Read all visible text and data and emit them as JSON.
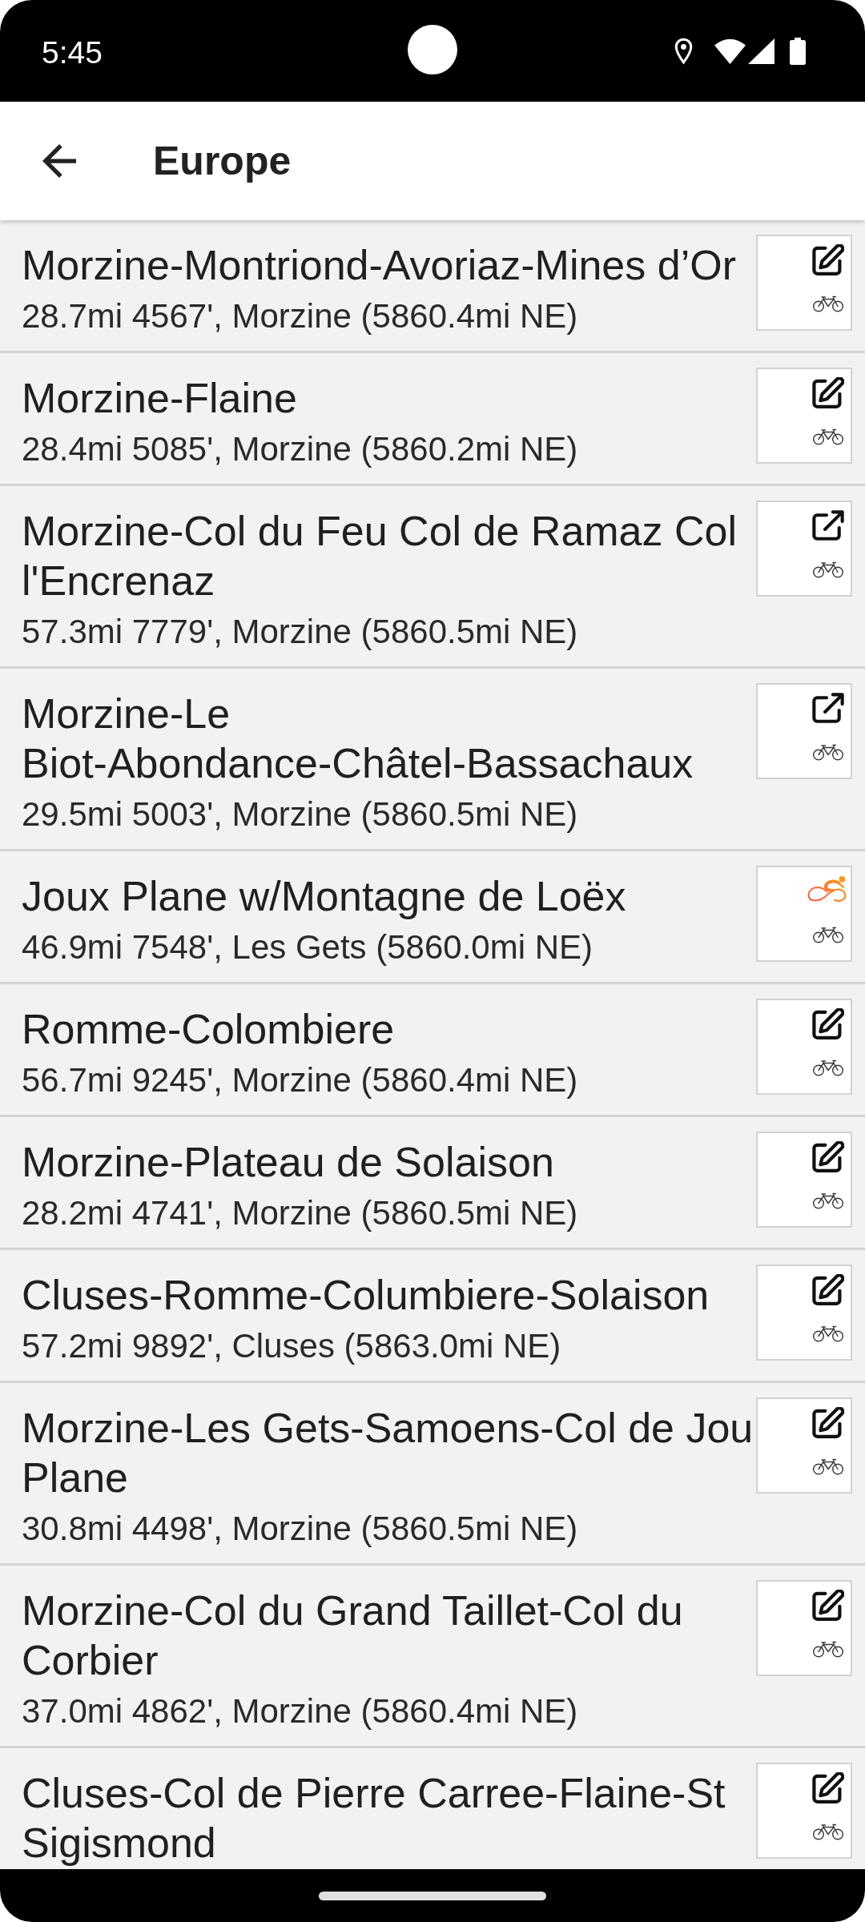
{
  "status_bar": {
    "time": "5:45"
  },
  "app_bar": {
    "title": "Europe"
  },
  "routes": [
    {
      "title": "Morzine-Montriond-Avoriaz-Mines d’Or",
      "details": "28.7mi 4567', Morzine (5860.4mi NE)",
      "kind": "edit"
    },
    {
      "title": "Morzine-Flaine",
      "details": "28.4mi 5085', Morzine (5860.2mi NE)",
      "kind": "edit"
    },
    {
      "title": "Morzine-Col du Feu Col de Ramaz Col\nl'Encrenaz",
      "details": "57.3mi 7779', Morzine (5860.5mi NE)",
      "kind": "external"
    },
    {
      "title": "Morzine-Le\nBiot-Abondance-Châtel-Bassachaux",
      "details": "29.5mi 5003', Morzine (5860.5mi NE)",
      "kind": "external"
    },
    {
      "title": "Joux Plane w/Montagne de Loëx",
      "details": "46.9mi 7548', Les Gets (5860.0mi NE)",
      "kind": "cyclist"
    },
    {
      "title": "Romme-Colombiere",
      "details": "56.7mi 9245', Morzine (5860.4mi NE)",
      "kind": "edit"
    },
    {
      "title": "Morzine-Plateau de Solaison",
      "details": "28.2mi 4741', Morzine (5860.5mi NE)",
      "kind": "edit"
    },
    {
      "title": "Cluses-Romme-Columbiere-Solaison",
      "details": "57.2mi 9892', Cluses (5863.0mi NE)",
      "kind": "edit"
    },
    {
      "title": "Morzine-Les Gets-Samoens-Col de Jou\nPlane",
      "details": "30.8mi 4498', Morzine (5860.5mi NE)",
      "kind": "edit"
    },
    {
      "title": "Morzine-Col du Grand Taillet-Col du\nCorbier",
      "details": "37.0mi 4862', Morzine (5860.4mi NE)",
      "kind": "edit"
    },
    {
      "title": "Cluses-Col de Pierre Carree-Flaine-St\nSigismond",
      "kind": "edit"
    }
  ]
}
